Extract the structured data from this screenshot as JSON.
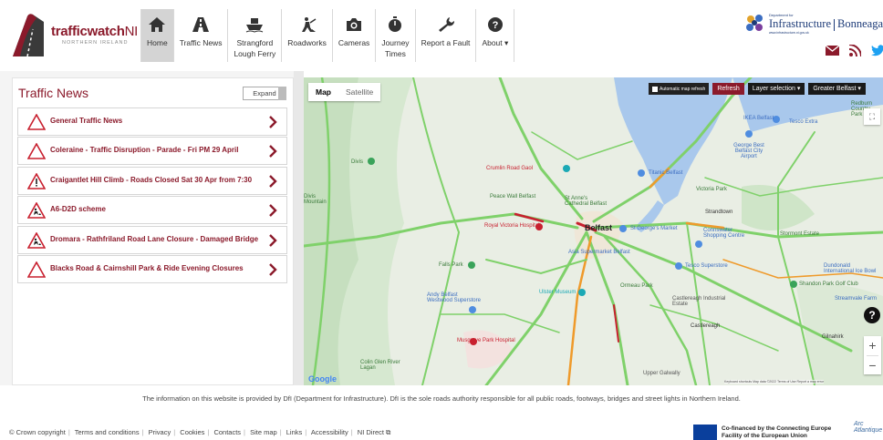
{
  "header": {
    "logo": {
      "brand_bold": "trafficwatch",
      "brand_suffix": "NI",
      "subtitle": "NORTHERN IRELAND"
    },
    "nav": [
      {
        "label": "Home",
        "icon": "home-icon",
        "active": true
      },
      {
        "label": "Traffic News",
        "icon": "traffic-news-icon",
        "active": false
      },
      {
        "label": "Strangford\nLough Ferry",
        "icon": "ferry-icon",
        "active": false
      },
      {
        "label": "Roadworks",
        "icon": "roadworks-icon",
        "active": false
      },
      {
        "label": "Cameras",
        "icon": "camera-icon",
        "active": false
      },
      {
        "label": "Journey\nTimes",
        "icon": "stopwatch-icon",
        "active": false
      },
      {
        "label": "Report a Fault",
        "icon": "wrench-icon",
        "active": false
      },
      {
        "label": "About ▾",
        "icon": "help-icon",
        "active": false
      }
    ],
    "dept": {
      "small": "Department for",
      "name": "Infrastructure",
      "irish_small": "An Roinn",
      "irish_name": "Bonneagai",
      "url": "www.infrastructure-ni.gov.uk"
    },
    "social": [
      "email-icon",
      "rss-icon",
      "twitter-icon"
    ]
  },
  "news": {
    "title": "Traffic News",
    "expand_label": "Expand",
    "items": [
      {
        "text": "General Traffic News",
        "icon": "warning-triangle-icon"
      },
      {
        "text": "Coleraine - Traffic Disruption - Parade - Fri PM 29 April",
        "icon": "warning-triangle-icon"
      },
      {
        "text": "Craigantlet Hill Climb - Roads Closed Sat 30 Apr from 7:30",
        "icon": "warning-exclamation-icon"
      },
      {
        "text": "A6-D2D scheme",
        "icon": "roadworks-triangle-icon"
      },
      {
        "text": "Dromara - Rathfriland Road Lane Closure - Damaged Bridge",
        "icon": "roadworks-triangle-icon"
      },
      {
        "text": "Blacks Road & Cairnshill Park & Ride Evening Closures",
        "icon": "warning-triangle-icon"
      }
    ]
  },
  "map": {
    "type_map": "Map",
    "type_satellite": "Satellite",
    "auto_refresh": "Automatic map refresh",
    "refresh": "Refresh",
    "layer_selection": "Layer selection ▾",
    "area": "Greater Belfast ▾",
    "zoom_in": "+",
    "zoom_out": "−",
    "google": "Google",
    "attribution": "Keyboard shortcuts   Map data ©2022   Terms of Use   Report a map error",
    "labels": [
      "Belfast",
      "Divis",
      "Divis Mountain",
      "Crumlin Road Gaol",
      "Titanic Belfast",
      "IKEA Belfast",
      "Tesco Extra",
      "George Best Belfast City Airport",
      "Victoria Park",
      "Strandtown",
      "Peace Wall Belfast",
      "St Anne's Cathedral Belfast",
      "Royal Victoria Hospital",
      "St George's Market",
      "Connswater Shopping Centre",
      "Stormont Estate",
      "Falls Park",
      "Asia Supermarket Belfast",
      "Tesco Superstore",
      "Dundonald International Ice Bowl",
      "Ulster Museum",
      "Ormeau Park",
      "Shandon Park Golf Club",
      "Andy Belfast Westwood Superstore",
      "Castlereagh Industrial Estate",
      "Streamvale Farm",
      "Castlereagh",
      "Gilnahirk",
      "Musgrave Park Hospital",
      "Colin Glen River Lagan",
      "Redburn Country Park",
      "Upper Galwally"
    ]
  },
  "footer": {
    "disclaimer": "The information on this website is provided by DfI (Department for Infrastructure). DfI is the sole roads authority responsible for all public roads, footways, bridges and street lights in Northern Ireland.",
    "links": [
      "© Crown copyright",
      "Terms and conditions",
      "Privacy",
      "Cookies",
      "Contacts",
      "Site map",
      "Links",
      "Accessibility",
      "NI Direct"
    ],
    "eu_text_1": "Co-financed by the Connecting Europe",
    "eu_text_2": "Facility of the European Union",
    "arc": "Arc Atlantique"
  }
}
